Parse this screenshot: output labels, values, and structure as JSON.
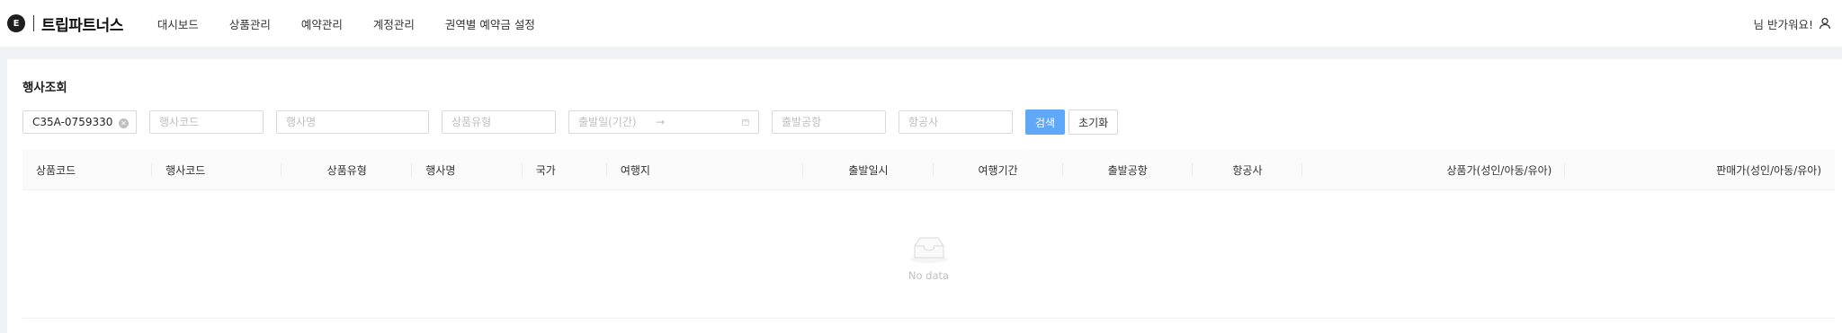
{
  "header": {
    "logo_badge": "E",
    "brand": "트립파트너스",
    "nav": [
      "대시보드",
      "상품관리",
      "예약관리",
      "계정관리",
      "권역별 예약금 설정"
    ],
    "greeting": "님 반가워요!"
  },
  "main": {
    "title": "행사조회",
    "filters": {
      "code_value": "C35A-0759330",
      "event_code_placeholder": "행사코드",
      "event_name_placeholder": "행사명",
      "product_type_placeholder": "상품유형",
      "depart_date_placeholder": "출발일(기간)",
      "depart_airport_placeholder": "출발공항",
      "airline_placeholder": "항공사",
      "search_label": "검색",
      "reset_label": "초기화"
    },
    "table": {
      "columns": [
        "상품코드",
        "행사코드",
        "상품유형",
        "행사명",
        "국가",
        "여행지",
        "출발일시",
        "여행기간",
        "출발공항",
        "항공사",
        "상품가(성인/아동/유아)",
        "판매가(성인/아동/유아)"
      ],
      "empty_text": "No data"
    }
  },
  "colors": {
    "primary": "#5ea8f7",
    "border": "#d9d9d9",
    "background": "#f0f2f5"
  },
  "icons": [
    "clear-icon",
    "calendar-icon",
    "user-icon",
    "empty-inbox-icon"
  ]
}
